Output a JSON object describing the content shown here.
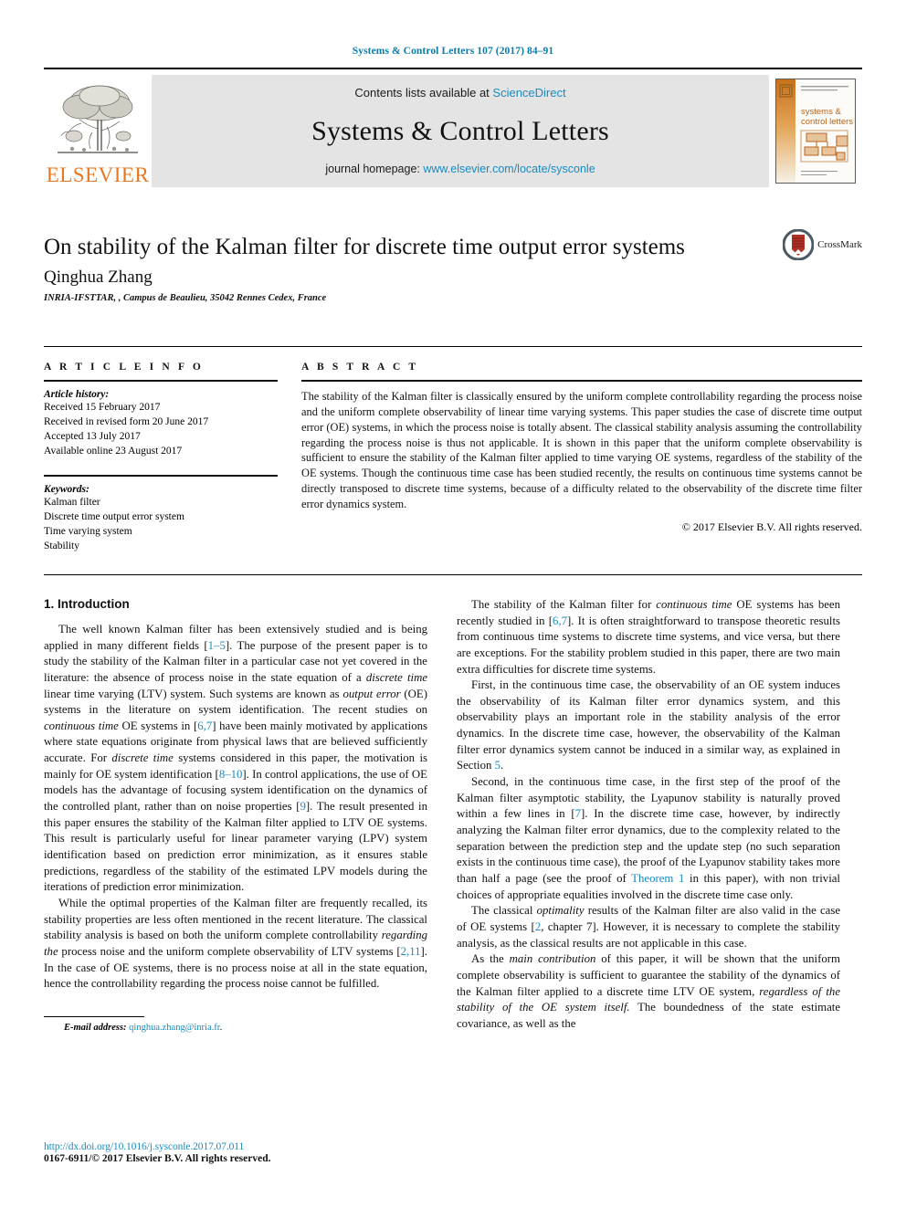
{
  "running_head": "Systems & Control Letters 107 (2017) 84–91",
  "masthead": {
    "publisher_name": "ELSEVIER",
    "contents_prefix": "Contents lists available at ",
    "contents_link": "ScienceDirect",
    "journal_title": "Systems & Control Letters",
    "homepage_prefix": "journal homepage: ",
    "homepage_link": "www.elsevier.com/locate/sysconle",
    "cover_title_line1": "systems &",
    "cover_title_line2": "control letters"
  },
  "article": {
    "title": "On stability of the Kalman filter for discrete time output error systems",
    "author": "Qinghua Zhang",
    "affiliation": "INRIA-IFSTTAR, , Campus de Beaulieu, 35042 Rennes Cedex, France",
    "crossmark_label": "CrossMark"
  },
  "info": {
    "heading": "A R T I C L E   I N F O",
    "history_label": "Article history:",
    "history": [
      "Received 15 February 2017",
      "Received in revised form 20 June 2017",
      "Accepted 13 July 2017",
      "Available online 23 August 2017"
    ],
    "keywords_label": "Keywords:",
    "keywords": [
      "Kalman filter",
      "Discrete time output error system",
      "Time varying system",
      "Stability"
    ]
  },
  "abstract": {
    "heading": "A B S T R A C T",
    "text": "The stability of the Kalman filter is classically ensured by the uniform complete controllability regarding the process noise and the uniform complete observability of linear time varying systems. This paper studies the case of discrete time output error (OE) systems, in which the process noise is totally absent. The classical stability analysis assuming the controllability regarding the process noise is thus not applicable. It is shown in this paper that the uniform complete observability is sufficient to ensure the stability of the Kalman filter applied to time varying OE systems, regardless of the stability of the OE systems. Though the continuous time case has been studied recently, the results on continuous time systems cannot be directly transposed to discrete time systems, because of a difficulty related to the observability of the discrete time filter error dynamics system.",
    "copyright": "© 2017 Elsevier B.V. All rights reserved."
  },
  "body": {
    "section_title": "1. Introduction",
    "left_paragraphs": [
      {
        "parts": [
          {
            "t": "The well known Kalman filter has been extensively studied and is being applied in many different fields ["
          },
          {
            "t": "1–5",
            "style": "link"
          },
          {
            "t": "]. The purpose of the present paper is to study the stability of the Kalman filter in a particular case not yet covered in the literature: the absence of process noise in the state equation of a "
          },
          {
            "t": "discrete time",
            "style": "italic"
          },
          {
            "t": " linear time varying (LTV) system. Such systems are known as "
          },
          {
            "t": "output error",
            "style": "italic"
          },
          {
            "t": " (OE) systems in the literature on system identification. The recent studies on "
          },
          {
            "t": "continuous time",
            "style": "italic"
          },
          {
            "t": " OE systems in ["
          },
          {
            "t": "6,7",
            "style": "link"
          },
          {
            "t": "] have been mainly motivated by applications where state equations originate from physical laws that are believed sufficiently accurate. For "
          },
          {
            "t": "discrete time",
            "style": "italic"
          },
          {
            "t": " systems considered in this paper, the motivation is mainly for OE system identification ["
          },
          {
            "t": "8–10",
            "style": "link"
          },
          {
            "t": "]. In control applications, the use of OE models has the advantage of focusing system identification on the dynamics of the controlled plant, rather than on noise properties ["
          },
          {
            "t": "9",
            "style": "link"
          },
          {
            "t": "]. The result presented in this paper ensures the stability of the Kalman filter applied to LTV OE systems. This result is particularly useful for linear parameter varying (LPV) system identification based on prediction error minimization, as it ensures stable predictions, regardless of the stability of the estimated LPV models during the iterations of prediction error minimization."
          }
        ]
      },
      {
        "parts": [
          {
            "t": "While the optimal properties of the Kalman filter are frequently recalled, its stability properties are less often mentioned in the recent literature. The classical stability analysis is based on both the uniform complete controllability "
          },
          {
            "t": "regarding the",
            "style": "italic"
          },
          {
            "t": " process noise and the uniform complete observability of LTV systems ["
          },
          {
            "t": "2,11",
            "style": "link"
          },
          {
            "t": "]. In the case of OE systems, there is no process noise at all in the state equation, hence the controllability regarding the process noise cannot be fulfilled."
          }
        ]
      }
    ],
    "right_paragraphs": [
      {
        "parts": [
          {
            "t": "The stability of the Kalman filter for "
          },
          {
            "t": "continuous time",
            "style": "italic"
          },
          {
            "t": " OE systems has been recently studied in ["
          },
          {
            "t": "6,7",
            "style": "link"
          },
          {
            "t": "]. It is often straightforward to transpose theoretic results from continuous time systems to discrete time systems, and vice versa, but there are exceptions. For the stability problem studied in this paper, there are two main extra difficulties for discrete time systems."
          }
        ]
      },
      {
        "parts": [
          {
            "t": "First, in the continuous time case, the observability of an OE system induces the observability of its Kalman filter error dynamics system, and this observability plays an important role in the stability analysis of the error dynamics. In the discrete time case, however, the observability of the Kalman filter error dynamics system cannot be induced in a similar way, as explained in Section "
          },
          {
            "t": "5",
            "style": "link"
          },
          {
            "t": "."
          }
        ]
      },
      {
        "parts": [
          {
            "t": "Second, in the continuous time case, in the first step of the proof of the Kalman filter asymptotic stability, the Lyapunov stability is naturally proved within a few lines in ["
          },
          {
            "t": "7",
            "style": "link"
          },
          {
            "t": "]. In the discrete time case, however, by indirectly analyzing the Kalman filter error dynamics, due to the complexity related to the separation between the prediction step and the update step (no such separation exists in the continuous time case), the proof of the Lyapunov stability takes more than half a page (see the proof of "
          },
          {
            "t": "Theorem 1",
            "style": "link"
          },
          {
            "t": " in this paper), with non trivial choices of appropriate equalities involved in the discrete time case only."
          }
        ]
      },
      {
        "parts": [
          {
            "t": "The classical "
          },
          {
            "t": "optimality",
            "style": "italic"
          },
          {
            "t": " results of the Kalman filter are also valid in the case of OE systems ["
          },
          {
            "t": "2",
            "style": "link"
          },
          {
            "t": ", chapter 7]. However, it is necessary to complete the stability analysis, as the classical results are not applicable in this case."
          }
        ]
      },
      {
        "parts": [
          {
            "t": "As the "
          },
          {
            "t": "main contribution",
            "style": "italic"
          },
          {
            "t": " of this paper, it will be shown that the uniform complete observability is sufficient to guarantee the stability of the dynamics of the Kalman filter applied to a discrete time LTV OE system, "
          },
          {
            "t": "regardless of the stability of the OE system itself.",
            "style": "italic"
          },
          {
            "t": " The boundedness of the state estimate covariance, as well as the"
          }
        ]
      }
    ]
  },
  "footnote": {
    "label": "E-mail address:",
    "email": "qinghua.zhang@inria.fr",
    "trailing": "."
  },
  "footer": {
    "doi": "http://dx.doi.org/10.1016/j.sysconle.2017.07.011",
    "issn": "0167-6911/© 2017 Elsevier B.V. All rights reserved."
  },
  "colors": {
    "link": "#1a8ac0",
    "elsevier_orange": "#e87722",
    "band": "#e4e4e4"
  }
}
